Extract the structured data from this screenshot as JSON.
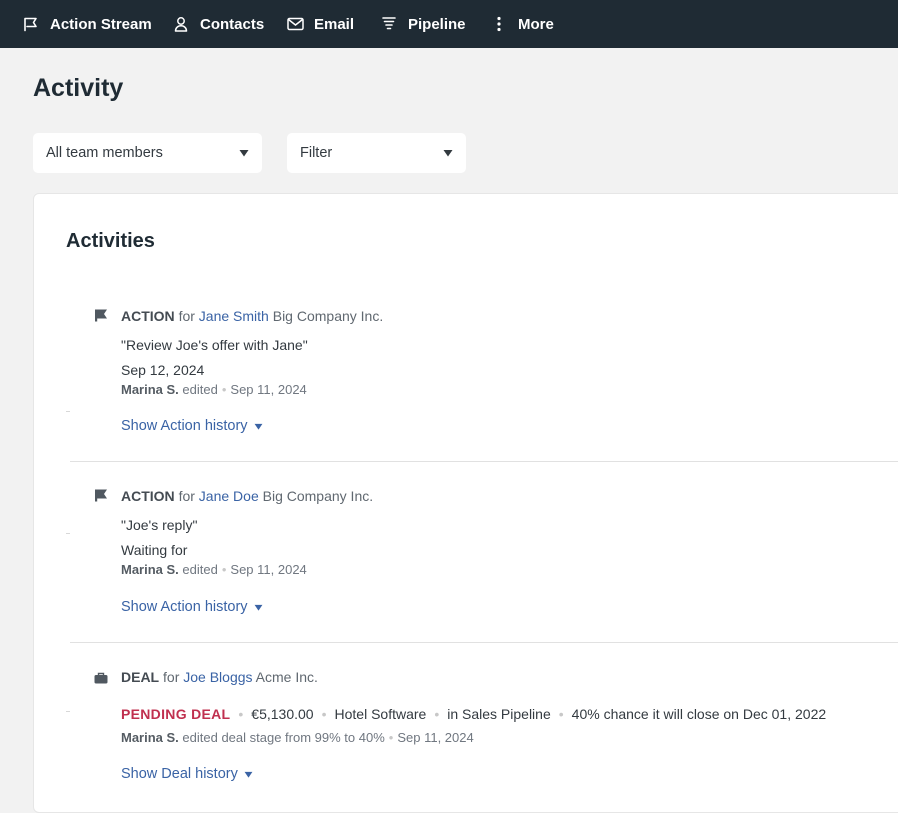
{
  "nav": {
    "items": [
      {
        "label": "Action Stream",
        "icon": "flag-icon"
      },
      {
        "label": "Contacts",
        "icon": "person-icon"
      },
      {
        "label": "Email",
        "icon": "envelope-icon"
      },
      {
        "label": "Pipeline",
        "icon": "funnel-icon"
      },
      {
        "label": "More",
        "icon": "vertical-dots-icon"
      }
    ]
  },
  "page": {
    "title": "Activity"
  },
  "filters": {
    "team": {
      "value": "All team members",
      "icon": "caret-down-icon"
    },
    "filter": {
      "value": "Filter",
      "icon": "caret-down-icon"
    }
  },
  "panel": {
    "title": "Activities",
    "activities": [
      {
        "type": "ACTION",
        "for_word": "for",
        "contact": "Jane Smith",
        "company": "Big Company Inc.",
        "text": "\"Review Joe's offer with Jane\"",
        "detail": "Sep 12, 2024",
        "author": "Marina S.",
        "verb": "edited",
        "date": "Sep 11, 2024",
        "history_label": "Show Action history",
        "icon": "flag-icon"
      },
      {
        "type": "ACTION",
        "for_word": "for",
        "contact": "Jane Doe",
        "company": "Big Company Inc.",
        "text": "\"Joe's reply\"",
        "detail": "Waiting for",
        "author": "Marina S.",
        "verb": "edited",
        "date": "Sep 11, 2024",
        "history_label": "Show Action history",
        "icon": "flag-icon"
      },
      {
        "type": "DEAL",
        "for_word": "for",
        "contact": "Joe Bloggs",
        "company": "Acme Inc.",
        "stage": "PENDING DEAL",
        "amount": "€5,130.00",
        "product": "Hotel Software",
        "pipeline": "in Sales Pipeline",
        "chance": "40% chance it will close on Dec 01, 2022",
        "author": "Marina S.",
        "verb": "edited deal stage from 99% to 40%",
        "date": "Sep 11, 2024",
        "history_label": "Show Deal history",
        "icon": "briefcase-icon"
      }
    ]
  },
  "colors": {
    "nav_bg": "#1f2b34",
    "link": "#3a63a5",
    "pending_stage": "#c0304f",
    "page_bg": "#f2f2f2"
  }
}
